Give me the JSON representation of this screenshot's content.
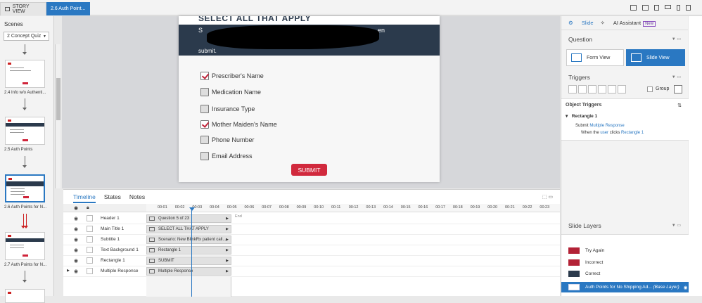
{
  "top_tabs": {
    "story_view": "STORY VIEW",
    "active_tab": "2.6 Auth Point..."
  },
  "scenes": {
    "title": "Scenes",
    "selected_scene": "2 Concept Quiz",
    "thumbnails": [
      {
        "label": ""
      },
      {
        "label": "2.4 Info w/o Authenti..."
      },
      {
        "label": "2.5 Auth Points"
      },
      {
        "label": "2.6 Auth Points for N..."
      },
      {
        "label": "2.7 Auth Points for N..."
      }
    ]
  },
  "slide": {
    "title": "SELECT ALL THAT APPLY",
    "scenario_start": "S",
    "scenario_end": "en",
    "scenario_line2": "submit.",
    "choices": [
      {
        "label": "Prescriber's Name",
        "checked": true
      },
      {
        "label": "Medication Name",
        "checked": false
      },
      {
        "label": "Insurance Type",
        "checked": false
      },
      {
        "label": "Mother Maiden's Name",
        "checked": true
      },
      {
        "label": "Phone Number",
        "checked": false
      },
      {
        "label": "Email Address",
        "checked": false
      }
    ],
    "submit_label": "SUBMIT",
    "accent_color": "#d1293d",
    "header_color": "#2b3a4c"
  },
  "timeline": {
    "tabs": [
      "Timeline",
      "States",
      "Notes"
    ],
    "ticks": [
      "00:01",
      "00:02",
      "00:03",
      "00:04",
      "00:05",
      "00:06",
      "00:07",
      "00:08",
      "00:09",
      "00:10",
      "00:11",
      "00:12",
      "00:13",
      "00:14",
      "00:15",
      "00:16",
      "00:17",
      "00:18",
      "00:19",
      "00:20",
      "00:21",
      "00:22",
      "00:23"
    ],
    "end_label": "End",
    "layers": [
      {
        "name": "Header 1",
        "bar": "Question 5 of 23"
      },
      {
        "name": "Main Title 1",
        "bar": "SELECT ALL THAT APPLY"
      },
      {
        "name": "Subtitle 1",
        "bar": "Scenario: New BlinkRx patient call..."
      },
      {
        "name": "Text Background 1",
        "bar": "Rectangle 1"
      },
      {
        "name": "Rectangle 1",
        "bar": "SUBMIT"
      },
      {
        "name": "Multiple Response",
        "bar": "Multiple Response"
      }
    ]
  },
  "right_panel": {
    "tab_slide": "Slide",
    "tab_ai": "AI Assistant",
    "new_badge": "New",
    "question_title": "Question",
    "form_view": "Form View",
    "slide_view": "Slide View",
    "triggers_title": "Triggers",
    "group_label": "Group",
    "object_triggers_title": "Object Triggers",
    "trigger_object": "Rectangle 1",
    "trigger_action_prefix": "Submit",
    "trigger_action_link": "Multiple Response",
    "trigger_when_prefix": "When the",
    "trigger_when_user": "user",
    "trigger_when_mid": "clicks",
    "trigger_when_object": "Rectangle 1",
    "slide_layers_title": "Slide Layers",
    "layers": [
      {
        "name": "Try Again"
      },
      {
        "name": "Incorrect"
      },
      {
        "name": "Correct"
      }
    ],
    "base_layer_name": "Auth Points for No Shipping Ad...",
    "base_layer_tag": "(Base Layer)"
  }
}
